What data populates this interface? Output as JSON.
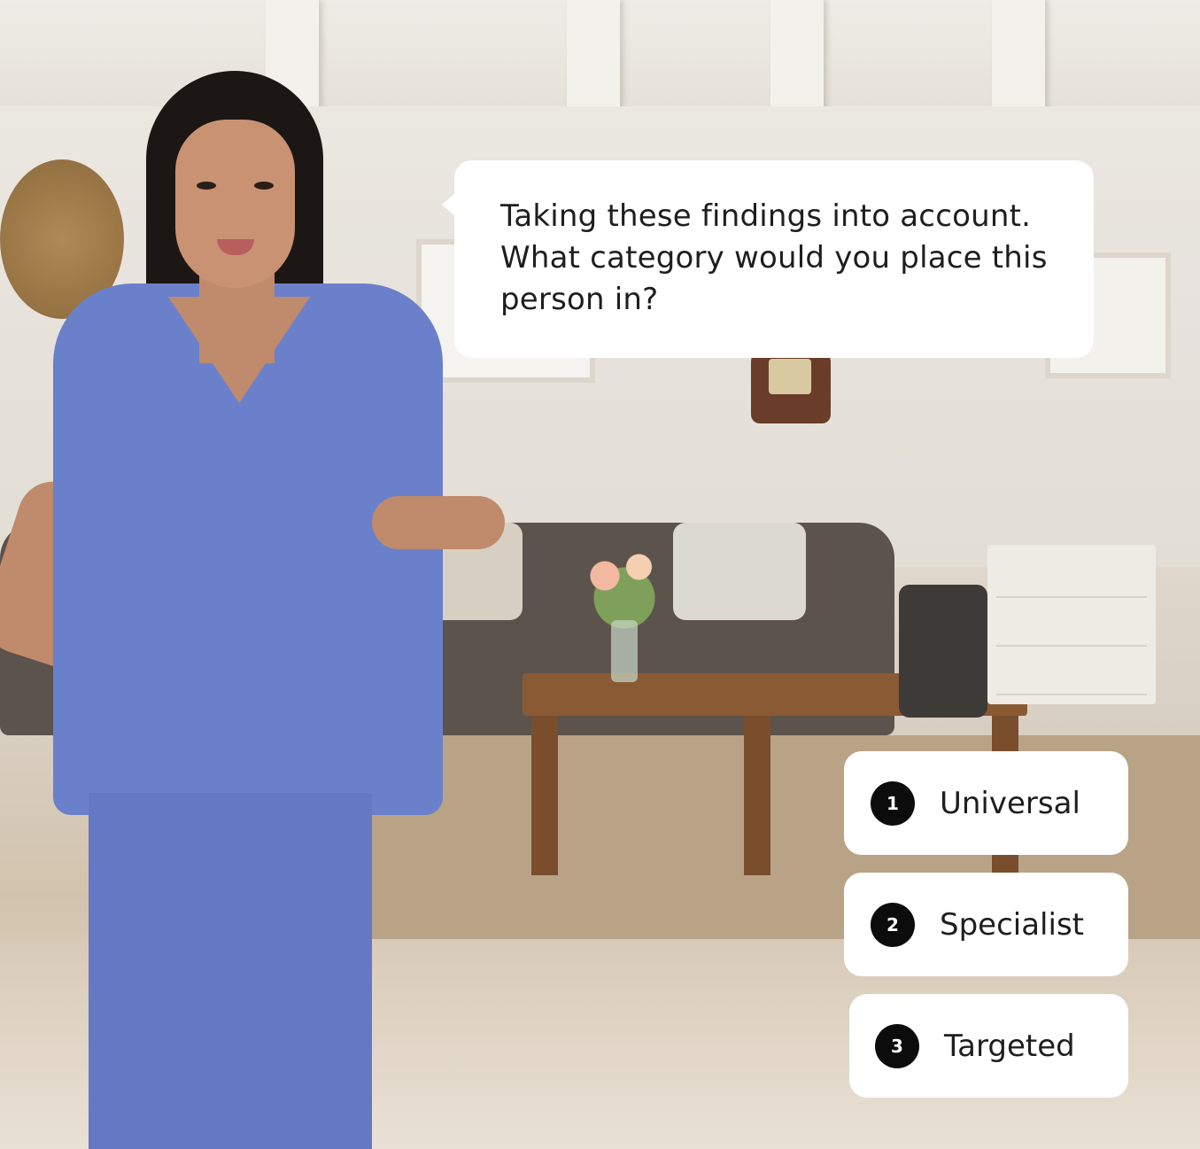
{
  "speech": {
    "text": "Taking these findings into account. What category would you place this person in?"
  },
  "options": [
    {
      "number": "1",
      "label": "Universal"
    },
    {
      "number": "2",
      "label": "Specialist"
    },
    {
      "number": "3",
      "label": "Targeted"
    }
  ],
  "colors": {
    "bubble_background": "#ffffff",
    "number_badge": "#0c0c0c",
    "scrubs": "#6b80cb"
  }
}
